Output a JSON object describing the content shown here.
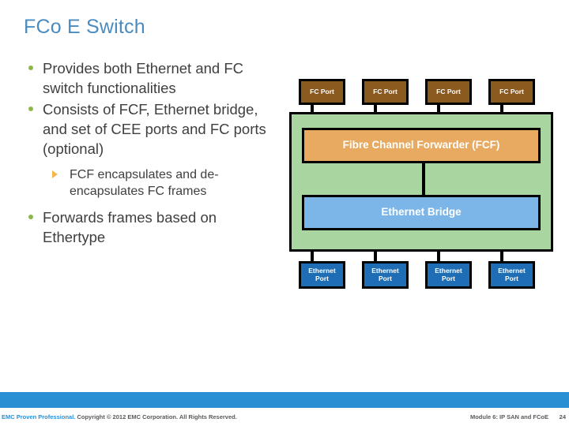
{
  "slide": {
    "title": "FCo E Switch",
    "title_color": "#4a8cc0"
  },
  "body": {
    "bullets": [
      {
        "level": 1,
        "marker": "round-dot",
        "text": "Provides both Ethernet and FC switch functionalities"
      },
      {
        "level": 1,
        "marker": "round-dot",
        "text": "Consists of FCF, Ethernet bridge, and set of CEE ports and FC ports (optional)"
      },
      {
        "level": 2,
        "marker": "triangle",
        "text": "FCF encapsulates and de-encapsulates FC frames"
      },
      {
        "level": 1,
        "marker": "round-dot",
        "text": "Forwards frames based on Ethertype"
      }
    ]
  },
  "diagram": {
    "fc_ports": [
      {
        "label": "FC Port"
      },
      {
        "label": "FC Port"
      },
      {
        "label": "FC Port"
      },
      {
        "label": "FC Port"
      }
    ],
    "fcf": {
      "label": "Fibre Channel Forwarder (FCF)",
      "color": "#e8a960"
    },
    "bridge": {
      "label": "Ethernet Bridge",
      "color": "#7cb6e8"
    },
    "chassis": {
      "color": "#a9d6a0"
    },
    "eth_ports": [
      {
        "line1": "Ethernet",
        "line2": "Port"
      },
      {
        "line1": "Ethernet",
        "line2": "Port"
      },
      {
        "line1": "Ethernet",
        "line2": "Port"
      },
      {
        "line1": "Ethernet",
        "line2": "Port"
      }
    ],
    "fc_port_color": "#8a5a1e",
    "eth_port_color": "#1f6eb5"
  },
  "footer": {
    "brand": "EMC Proven Professional.",
    "copyright": " Copyright © 2012 EMC Corporation. All Rights Reserved.",
    "module": "Module 6: IP SAN and FCoE",
    "page_number": "24",
    "bar_color": "#2b8fd4"
  }
}
